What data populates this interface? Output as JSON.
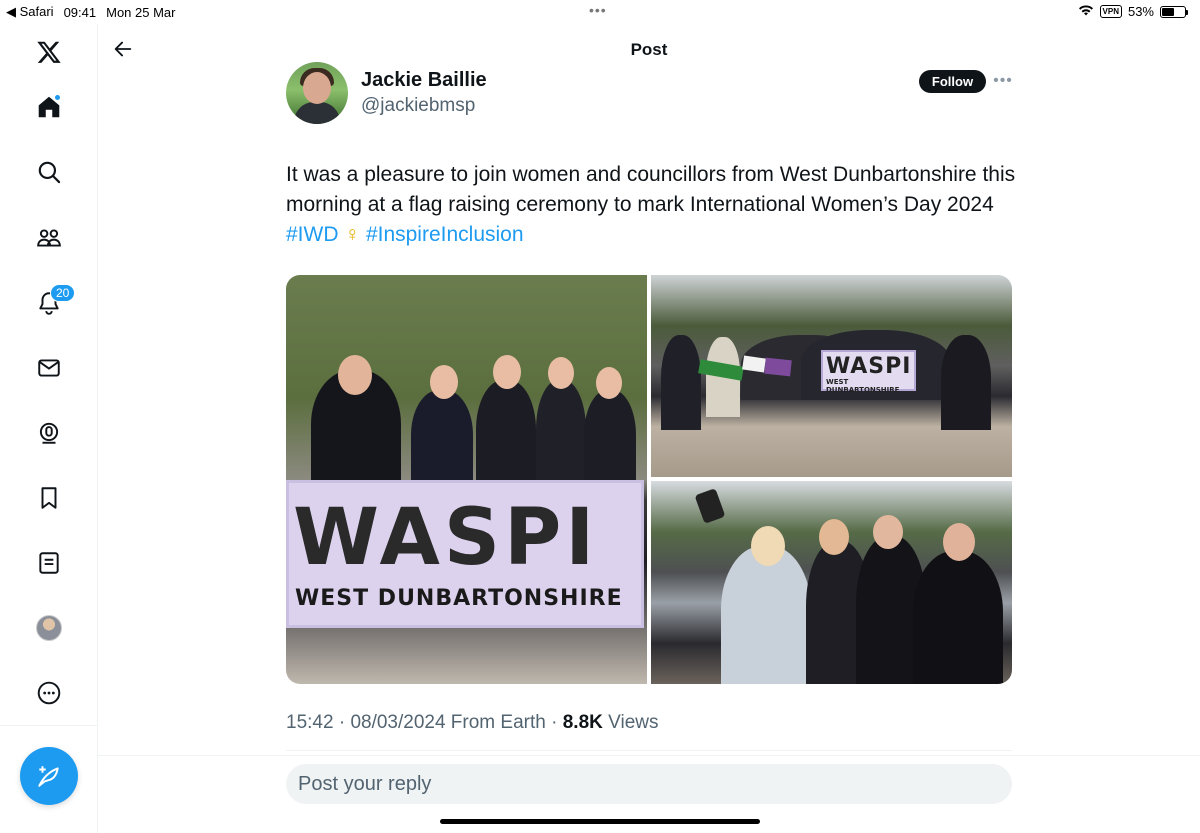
{
  "status_bar": {
    "back_app": "◀ Safari",
    "time": "09:41",
    "date": "Mon 25 Mar",
    "multitask_dots": "•••",
    "vpn": "VPN",
    "battery_percent": "53%",
    "battery_level": 0.53
  },
  "sidebar": {
    "items": [
      {
        "icon": "x-logo-icon"
      },
      {
        "icon": "home-icon",
        "has_dot": true
      },
      {
        "icon": "search-icon"
      },
      {
        "icon": "communities-icon"
      },
      {
        "icon": "notifications-icon",
        "badge": "20"
      },
      {
        "icon": "messages-icon"
      },
      {
        "icon": "spaces-icon"
      },
      {
        "icon": "bookmarks-icon"
      },
      {
        "icon": "lists-icon"
      },
      {
        "icon": "profile-avatar"
      },
      {
        "icon": "more-icon"
      }
    ],
    "compose_icon": "compose-feather-icon"
  },
  "header": {
    "title": "Post"
  },
  "tweet": {
    "author_name": "Jackie Baillie",
    "author_handle": "@jackiebmsp",
    "follow_label": "Follow",
    "more_label": "•••",
    "text_main": "It was a pleasure to join women and councillors from West Dunbartonshire this morning at a flag raising ceremony to mark International Women’s Day 2024 ",
    "hashtag_1": "#IWD",
    "venus_symbol": "♀",
    "hashtag_2": "#InspireInclusion",
    "media": {
      "banner_big": "WASPI",
      "banner_small": "WEST DUNBARTONSHIRE"
    },
    "time": "15:42",
    "separator": " · ",
    "date": "08/03/2024",
    "source": " From Earth",
    "views_count": "8.8K",
    "views_label": " Views"
  },
  "reply": {
    "placeholder": "Post your reply"
  },
  "colors": {
    "accent": "#1d9bf0",
    "text": "#0f1419",
    "secondary": "#536471",
    "follow_bg": "#0f1419"
  }
}
